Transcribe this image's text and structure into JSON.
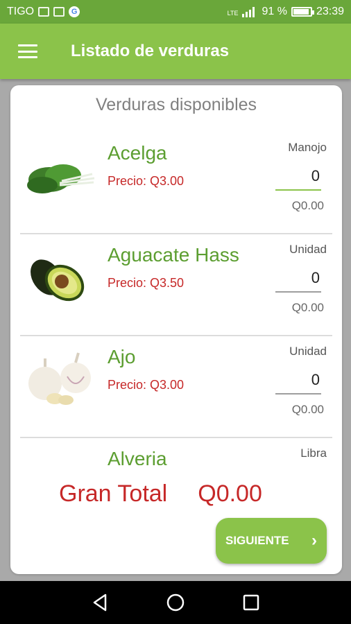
{
  "status": {
    "carrier": "TIGO",
    "network": "LTE",
    "battery": "91 %",
    "time": "23:39"
  },
  "app_bar": {
    "title": "Listado de verduras"
  },
  "card": {
    "title": "Verduras disponibles"
  },
  "items": [
    {
      "name": "Acelga",
      "price": "Precio: Q3.00",
      "unit": "Manojo",
      "qty": "0",
      "subtotal": "Q0.00",
      "image": "chard-image"
    },
    {
      "name": "Aguacate Hass",
      "price": "Precio: Q3.50",
      "unit": "Unidad",
      "qty": "0",
      "subtotal": "Q0.00",
      "image": "avocado-image"
    },
    {
      "name": "Ajo",
      "price": "Precio: Q3.00",
      "unit": "Unidad",
      "qty": "0",
      "subtotal": "Q0.00",
      "image": "garlic-image"
    },
    {
      "name": "Alveria",
      "price": "",
      "unit": "Libra",
      "qty": "",
      "subtotal": "",
      "image": "peas-image"
    }
  ],
  "total": {
    "label": "Gran Total",
    "value": "Q0.00"
  },
  "next_button": {
    "label": "SIGUIENTE",
    "icon": "chevron-right-icon"
  },
  "colors": {
    "status_bar": "#6aa73a",
    "app_bar": "#8bc34a",
    "item_name": "#5c9e31",
    "price": "#c62828"
  }
}
